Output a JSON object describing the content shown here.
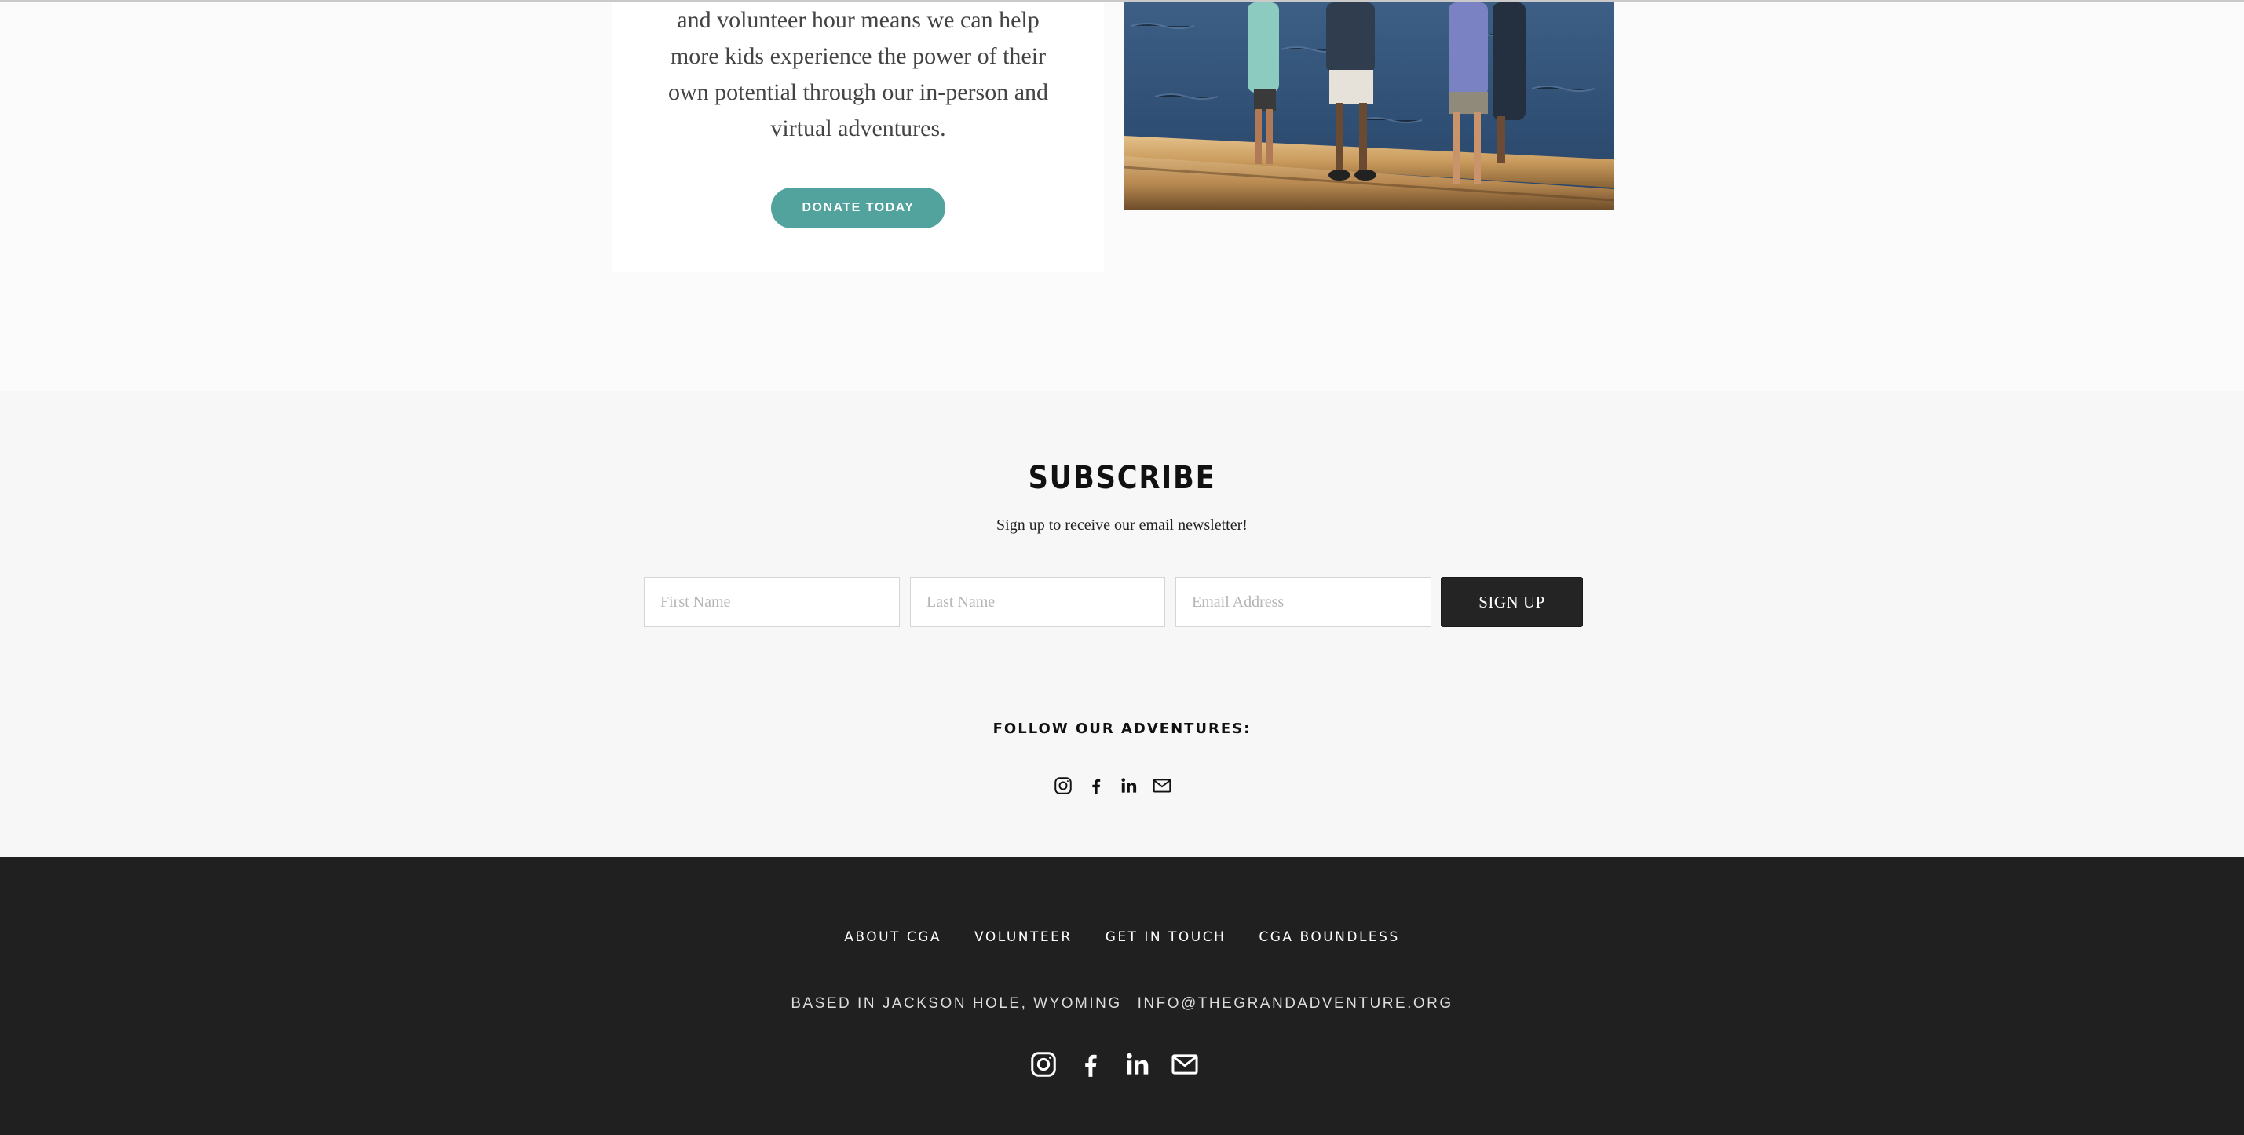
{
  "colors": {
    "accent": "#52a39d",
    "footer_bg": "#202020",
    "subscribe_bg": "#f7f7f7",
    "button_dark": "#242424"
  },
  "donate": {
    "text_lines": [
      "and volunteer hour means we can help",
      "more kids experience the power of their",
      "own potential through our in-person and",
      "virtual adventures."
    ],
    "button_label": "DONATE TODAY"
  },
  "subscribe": {
    "title": "SUBSCRIBE",
    "subtitle": "Sign up to receive our email newsletter!",
    "first_name_placeholder": "First Name",
    "last_name_placeholder": "Last Name",
    "email_placeholder": "Email Address",
    "button_label": "SIGN UP",
    "follow_label": "FOLLOW OUR ADVENTURES:",
    "social_icons": [
      "instagram-icon",
      "facebook-icon",
      "linkedin-icon",
      "email-icon"
    ]
  },
  "footer": {
    "nav": [
      "ABOUT CGA",
      "VOLUNTEER",
      "GET IN TOUCH",
      "CGA BOUNDLESS"
    ],
    "location": "BASED IN JACKSON HOLE, WYOMING",
    "email": "INFO@THEGRANDADVENTURE.ORG",
    "social_icons": [
      "instagram-icon",
      "facebook-icon",
      "linkedin-icon",
      "email-icon"
    ]
  }
}
